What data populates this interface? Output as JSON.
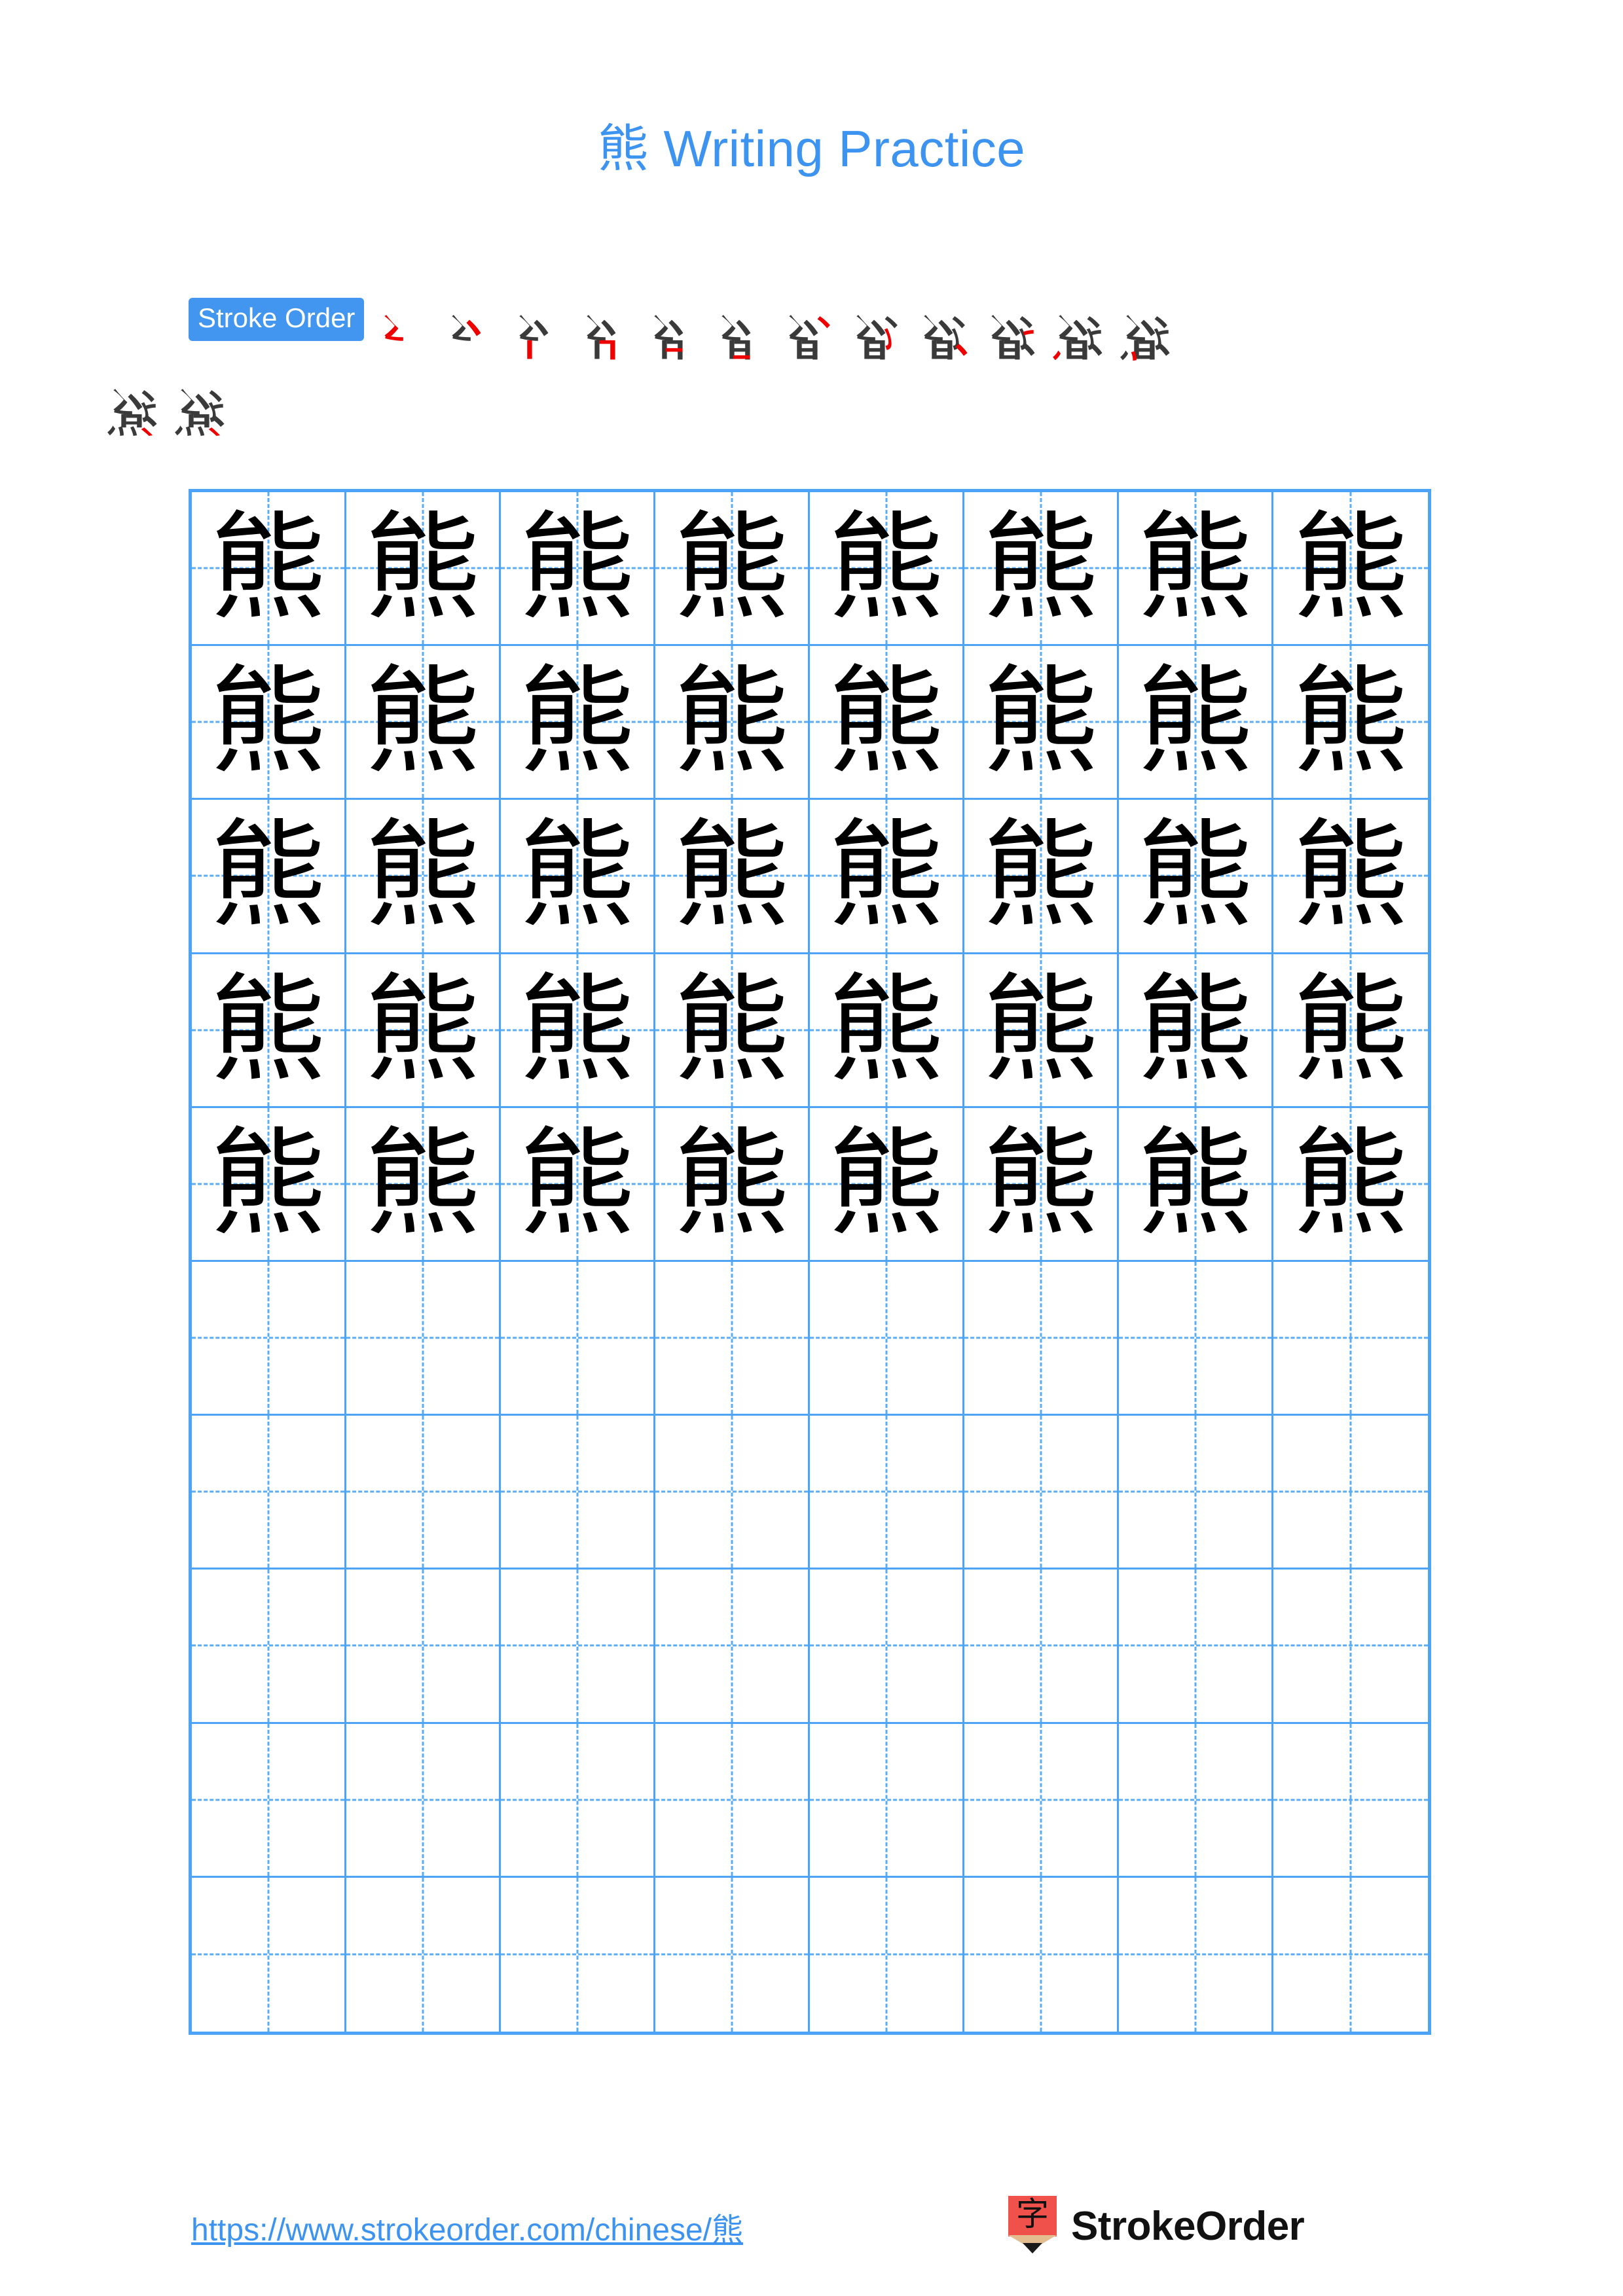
{
  "page": {
    "character": "熊",
    "title_suffix": " Writing Practice",
    "title_full": "熊 Writing Practice",
    "background": "#ffffff"
  },
  "colors": {
    "title_blue": "#3D93F0",
    "badge_blue": "#4296F0",
    "grid_blue": "#4DA3F5",
    "grid_dash_blue": "#5BACF7",
    "char_dark": "#333333",
    "char_light": "#DEDEDE",
    "stroke_new_red": "#EF0000",
    "stroke_past_gray": "#3A3A3A",
    "logo_red": "#F0524B",
    "logo_wood": "#E3BC8F"
  },
  "stroke_order": {
    "label": "Stroke Order",
    "total_strokes": 14,
    "row1_count": 12,
    "row2_count": 2,
    "steps": [
      {
        "index": 1,
        "partial": "ㄑ"
      },
      {
        "index": 2,
        "partial": "厶"
      },
      {
        "index": 3,
        "partial": "彳"
      },
      {
        "index": 4,
        "partial": "台"
      },
      {
        "index": 5,
        "partial": "台"
      },
      {
        "index": 6,
        "partial": "自"
      },
      {
        "index": 7,
        "partial": "自"
      },
      {
        "index": 8,
        "partial": "能"
      },
      {
        "index": 9,
        "partial": "能"
      },
      {
        "index": 10,
        "partial": "能"
      },
      {
        "index": 11,
        "partial": "能"
      },
      {
        "index": 12,
        "partial": "能"
      },
      {
        "index": 13,
        "partial": "熊"
      },
      {
        "index": 14,
        "partial": "熊"
      }
    ]
  },
  "practice_grid": {
    "columns": 8,
    "rows": 10,
    "filled_rows": 5,
    "first_cell_style": "dark",
    "traced_cell_style": "light",
    "empty_rows_start": 6,
    "cell_character": "熊"
  },
  "footer": {
    "url": "https://www.strokeorder.com/chinese/熊",
    "brand_name": "StrokeOrder",
    "logo_glyph": "字"
  }
}
